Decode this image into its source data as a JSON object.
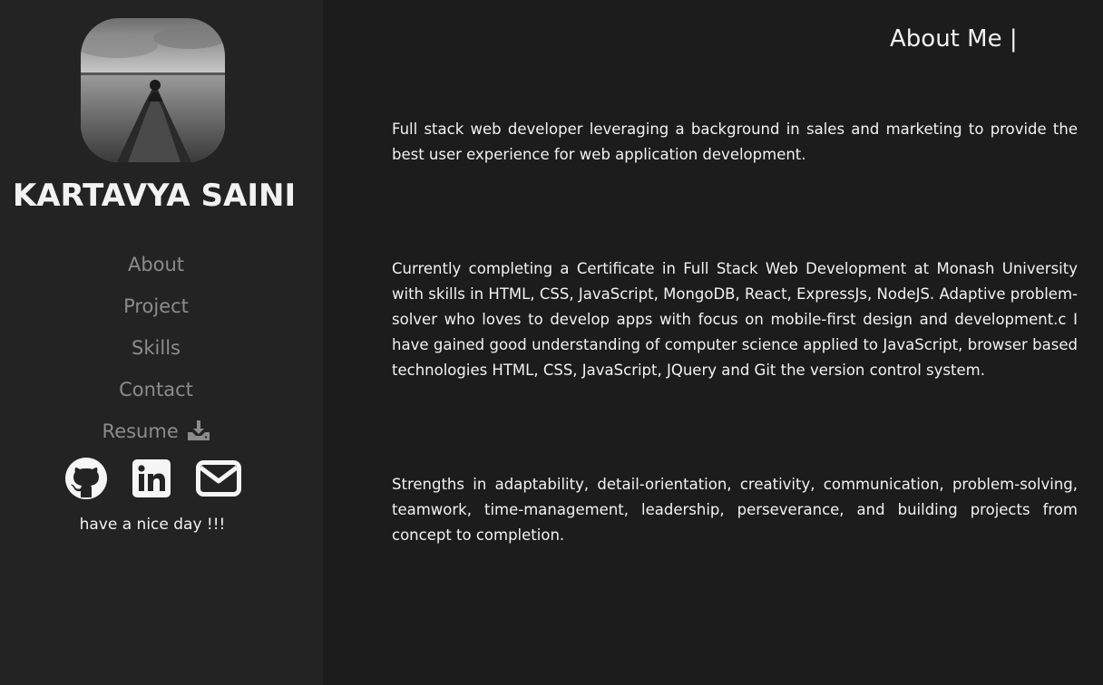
{
  "profile": {
    "name": "KARTAVYA SAINI",
    "avatar_alt": "profile photo"
  },
  "nav": {
    "items": [
      {
        "label": "About"
      },
      {
        "label": "Project"
      },
      {
        "label": "Skills"
      },
      {
        "label": "Contact"
      },
      {
        "label": "Resume",
        "icon": "download-icon"
      }
    ]
  },
  "socials": [
    {
      "name": "github-icon"
    },
    {
      "name": "linkedin-icon"
    },
    {
      "name": "email-icon"
    }
  ],
  "greeting": "have a nice day !!!",
  "main": {
    "title": "About Me |",
    "paragraphs": [
      "Full stack web developer leveraging a background in sales and marketing to provide the best user experience for web application development.",
      "Currently completing a Certificate in Full Stack Web Development at Monash University with skills in HTML, CSS, JavaScript, MongoDB, React, ExpressJs, NodeJS. Adaptive problem-solver who loves to develop apps with focus on mobile-first design and development.c I have gained good understanding of computer science applied to JavaScript, browser based technologies HTML, CSS, JavaScript, JQuery and Git the version control system.",
      "Strengths in adaptability, detail-orientation, creativity, communication, problem-solving, teamwork, time-management, leadership, perseverance, and building projects from concept to completion."
    ]
  },
  "colors": {
    "sidebar_bg": "#232323",
    "main_bg": "#1c1c1c",
    "text": "#f2f2f2",
    "nav_text": "#8c8c8c"
  }
}
